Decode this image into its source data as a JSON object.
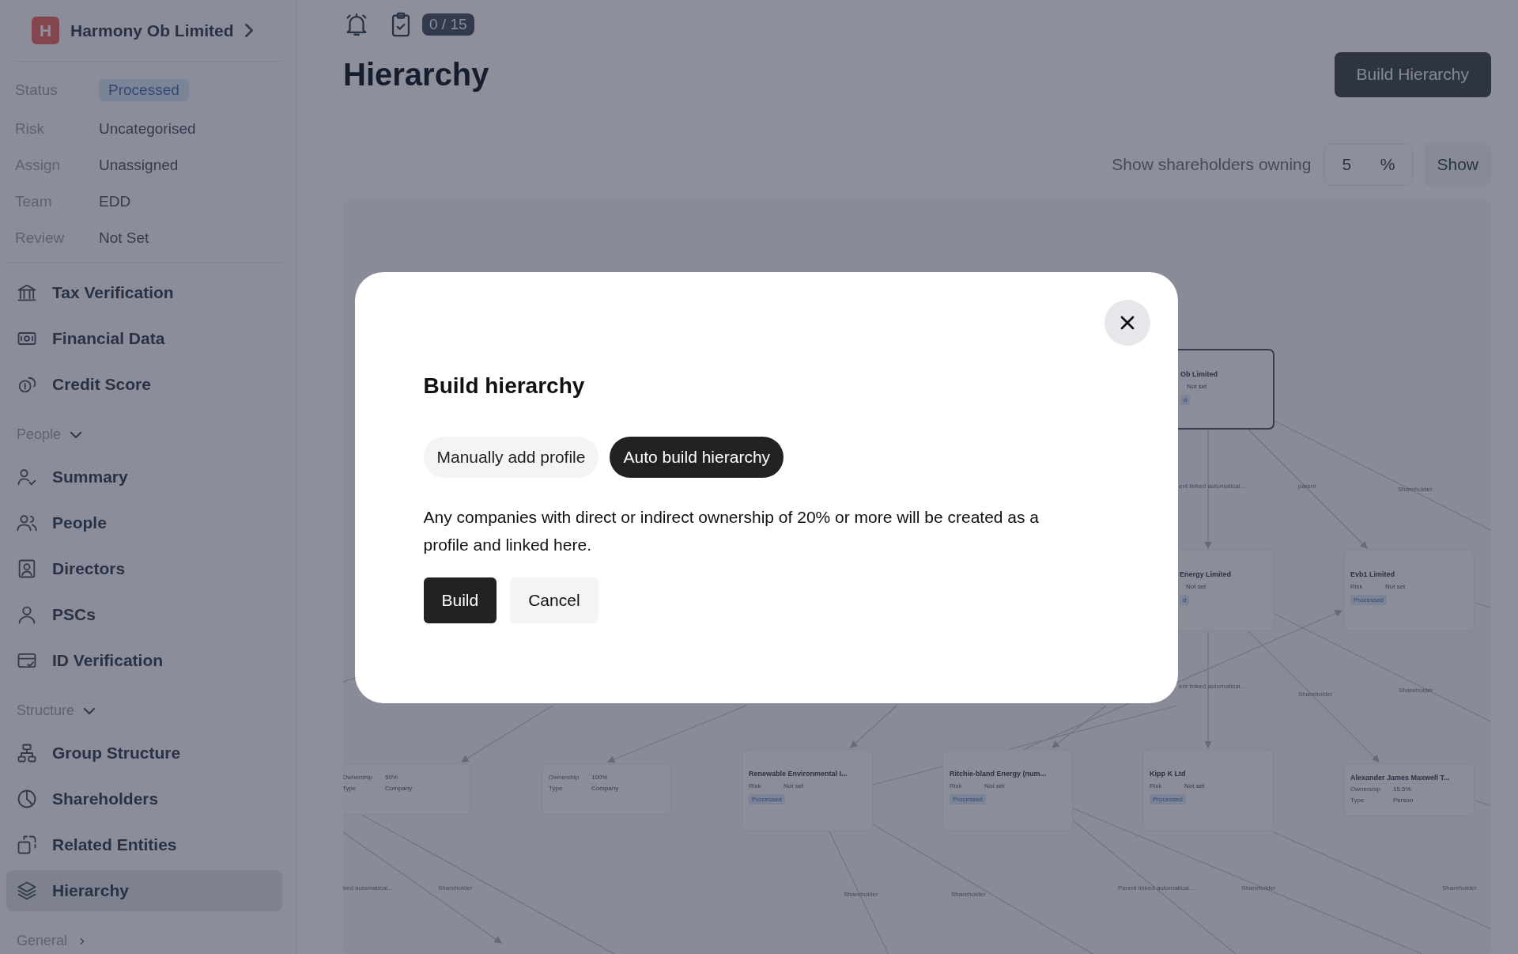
{
  "sidebar": {
    "entity": {
      "initial": "H",
      "name": "Harmony Ob Limited"
    },
    "details": [
      {
        "label": "Status",
        "value": "Processed",
        "kind": "badge"
      },
      {
        "label": "Risk",
        "value": "Uncategorised",
        "kind": "text"
      },
      {
        "label": "Assign",
        "value": "Unassigned",
        "kind": "text"
      },
      {
        "label": "Team",
        "value": "EDD",
        "kind": "text"
      },
      {
        "label": "Review",
        "value": "Not Set",
        "kind": "text"
      }
    ],
    "sections": [
      {
        "items": [
          {
            "label": "Tax Verification",
            "selected": false
          },
          {
            "label": "Financial Data",
            "selected": false
          },
          {
            "label": "Credit Score",
            "selected": false
          }
        ]
      },
      {
        "title": "People",
        "expanded": true,
        "items": [
          {
            "label": "Summary",
            "selected": false
          },
          {
            "label": "People",
            "selected": false
          },
          {
            "label": "Directors",
            "selected": false
          },
          {
            "label": "PSCs",
            "selected": false
          },
          {
            "label": "ID Verification",
            "selected": false
          }
        ]
      },
      {
        "title": "Structure",
        "expanded": true,
        "items": [
          {
            "label": "Group Structure",
            "selected": false
          },
          {
            "label": "Shareholders",
            "selected": false
          },
          {
            "label": "Related Entities",
            "selected": false
          },
          {
            "label": "Hierarchy",
            "selected": true
          }
        ]
      },
      {
        "title": "General",
        "expanded": false
      }
    ]
  },
  "topbar": {
    "tasks_count": "0 / 15"
  },
  "page": {
    "title": "Hierarchy",
    "action": "Build Hierarchy"
  },
  "filter": {
    "label": "Show shareholders owning",
    "value": "5",
    "unit": "%",
    "button": "Show"
  },
  "diagram": {
    "nodes": [
      {
        "kind": "entity",
        "name": "Ob Limited",
        "risk_value": "Not set",
        "status": "d"
      },
      {
        "kind": "entity",
        "name": "Energy Limited",
        "risk_value": "Not set",
        "status": "d"
      },
      {
        "kind": "entity",
        "name": "Evb1 Limited",
        "risk_label": "Risk",
        "risk_value": "Not set",
        "status": "Processed"
      },
      {
        "kind": "shareholder",
        "ownership_label": "Ownership",
        "ownership": "50%",
        "type_label": "Type",
        "type": "Company"
      },
      {
        "kind": "shareholder",
        "ownership_label": "Ownership",
        "ownership": "100%",
        "type_label": "Type",
        "type": "Company"
      },
      {
        "kind": "entity",
        "name": "Renewable Environmental I...",
        "risk_label": "Risk",
        "risk_value": "Not set",
        "status": "Processed"
      },
      {
        "kind": "entity",
        "name": "Ritchie-bland Energy (num...",
        "risk_label": "Risk",
        "risk_value": "Not set",
        "status": "Processed"
      },
      {
        "kind": "entity",
        "name": "Kipp K Ltd",
        "risk_label": "Risk",
        "risk_value": "Not set",
        "status": "Processed"
      },
      {
        "kind": "shareholder",
        "name": "Alexander James Maxwell T...",
        "ownership_label": "Ownership",
        "ownership": "15.5%",
        "type_label": "Type",
        "type": "Person"
      }
    ],
    "edge_labels": [
      "ent linked automatical...",
      "parent",
      "Shareholder",
      "ent linked automatical...",
      "Shareholder",
      "Shareholder",
      "ked automatical...",
      "Shareholder",
      "Shareholder",
      "Shareholder",
      "Parent linked automatical...",
      "Shareholder",
      "Shareholder"
    ]
  },
  "modal": {
    "title": "Build hierarchy",
    "options": [
      {
        "label": "Manually add profile",
        "selected": false
      },
      {
        "label": "Auto build hierarchy",
        "selected": true
      }
    ],
    "description": "Any companies with direct or indirect ownership of 20% or more will be created as a profile and linked here.",
    "actions": [
      {
        "label": "Build",
        "kind": "primary"
      },
      {
        "label": "Cancel",
        "kind": "secondary"
      }
    ]
  }
}
